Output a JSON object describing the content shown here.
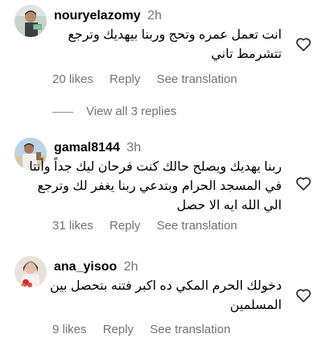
{
  "comments": [
    {
      "username": "nouryelazomy",
      "time": "2h",
      "lines": [
        "انت تعمل عمره وتحج وربنا بيهديك وترجع",
        "تتشرمط تاني"
      ],
      "likes": "20 likes",
      "reply": "Reply",
      "translate": "See translation",
      "view_replies": "View all 3 replies"
    },
    {
      "username": "gamal8144",
      "time": "3h",
      "lines": [
        "ربنا يهديك ويصلح حالك كنت فرحان ليك جداً وأنتا",
        "في المسجد الحرام وبتدعي ربنا يغفر لك وترجع",
        "الي الله ايه الا حصل"
      ],
      "likes": "31 likes",
      "reply": "Reply",
      "translate": "See translation"
    },
    {
      "username": "ana_yisoo",
      "time": "2h",
      "lines": [
        "دخولك الحرم المكي ده اكبر فتنه بتحصل بين",
        "المسلمين"
      ],
      "likes": "9 likes",
      "reply": "Reply",
      "translate": "See translation"
    }
  ],
  "icons": {
    "like": "heart-outline-icon"
  },
  "colors": {
    "text": "#000000",
    "secondary": "#737373"
  }
}
